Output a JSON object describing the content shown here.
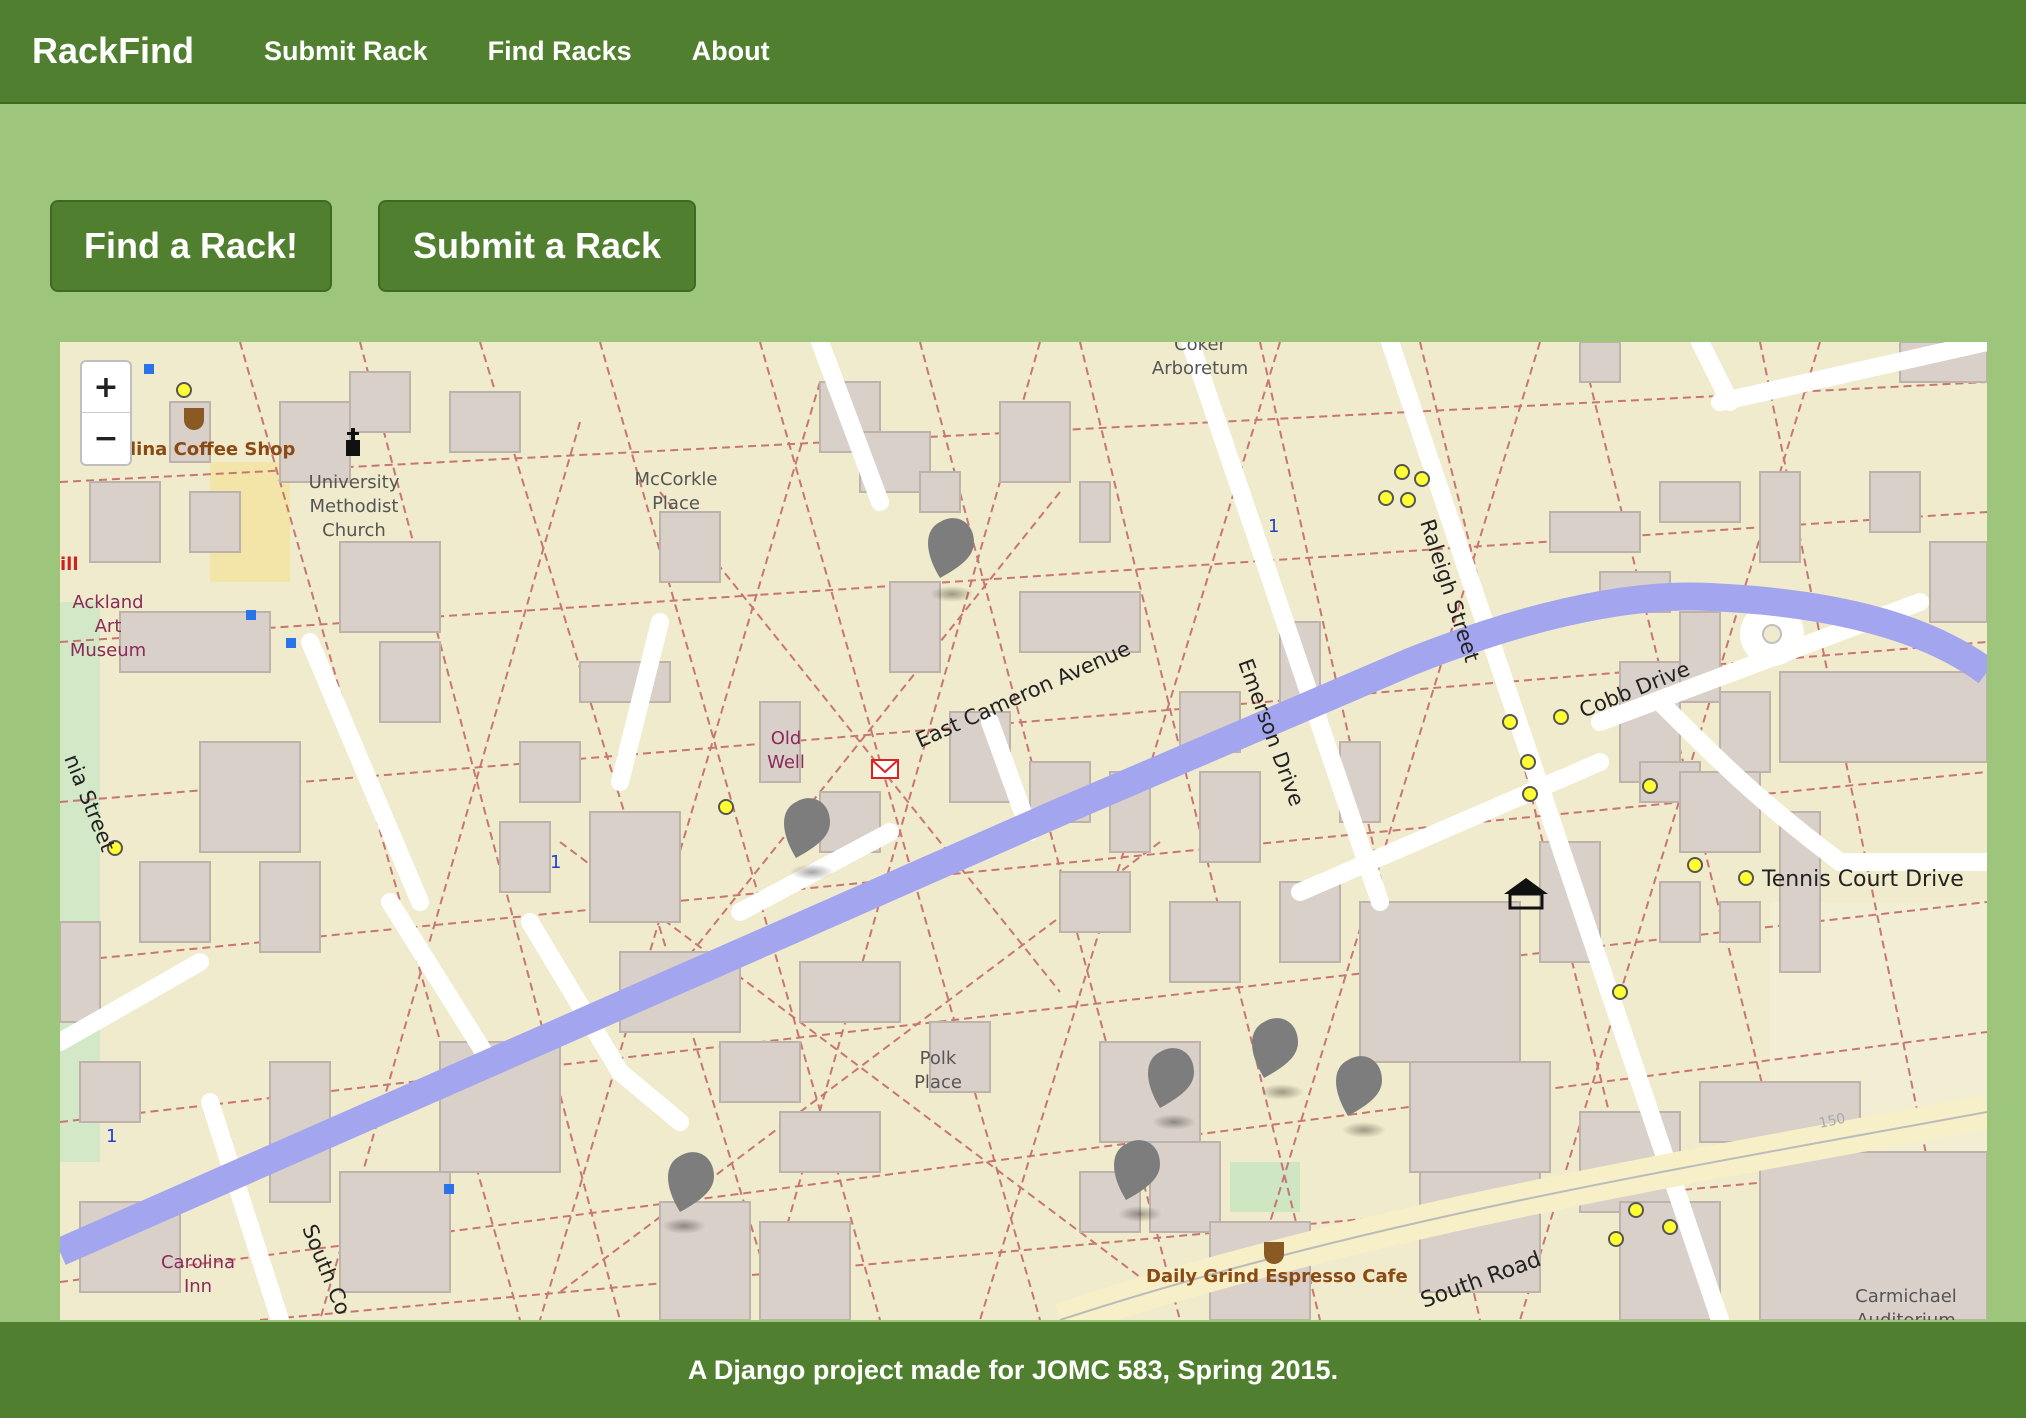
{
  "app": {
    "brand": "RackFind"
  },
  "nav": {
    "items": [
      {
        "label": "Submit Rack"
      },
      {
        "label": "Find Racks"
      },
      {
        "label": "About"
      }
    ]
  },
  "actions": {
    "find_label": "Find a Rack!",
    "submit_label": "Submit a Rack"
  },
  "map": {
    "zoom_in": "+",
    "zoom_out": "−",
    "marker_count": 7,
    "labels": {
      "coffee_shop": "lina Coffee Shop",
      "church_1": "University",
      "church_2": "Methodist",
      "church_3": "Church",
      "mccorkle_1": "McCorkle",
      "mccorkle_2": "Place",
      "coker_1": "Coker",
      "coker_2": "Arboretum",
      "ackland_1": "Ackland",
      "ackland_2": "Art",
      "ackland_3": "Museum",
      "ill": "ill",
      "old_well_1": "Old",
      "old_well_2": "Well",
      "east_cameron": "East Cameron Avenue",
      "raleigh": "Raleigh Street",
      "emerson": "Emerson Drive",
      "cobb": "Cobb Drive",
      "tennis": "Tennis Court Drive",
      "polk_1": "Polk",
      "polk_2": "Place",
      "south_road": "South Road",
      "daily_grind": "Daily Grind Espresso Cafe",
      "carolina_inn_1": "Carolina",
      "carolina_inn_2": "Inn",
      "carmichael_1": "Carmichael",
      "carmichael_2": "Auditorium",
      "south_co": "South Co",
      "street_left": "nia Street",
      "route_1": "1",
      "elev_150": "150"
    }
  },
  "footer": {
    "text": "A Django project made for JOMC 583, Spring 2015."
  }
}
